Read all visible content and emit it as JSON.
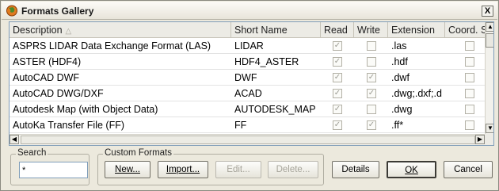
{
  "window": {
    "title": "Formats Gallery",
    "close_label": "X"
  },
  "table": {
    "columns": [
      "Description",
      "Short Name",
      "Read",
      "Write",
      "Extension",
      "Coord. S"
    ],
    "rows": [
      {
        "description": "ASPRS LIDAR Data Exchange Format (LAS)",
        "short_name": "LIDAR",
        "read": true,
        "write": false,
        "extension": ".las",
        "coord": false
      },
      {
        "description": "ASTER (HDF4)",
        "short_name": "HDF4_ASTER",
        "read": true,
        "write": false,
        "extension": ".hdf",
        "coord": false
      },
      {
        "description": "AutoCAD DWF",
        "short_name": "DWF",
        "read": true,
        "write": true,
        "extension": ".dwf",
        "coord": false
      },
      {
        "description": "AutoCAD DWG/DXF",
        "short_name": "ACAD",
        "read": true,
        "write": true,
        "extension": ".dwg;.dxf;.d",
        "coord": false
      },
      {
        "description": "Autodesk Map (with Object Data)",
        "short_name": "AUTODESK_MAP",
        "read": true,
        "write": false,
        "extension": ".dwg",
        "coord": false
      },
      {
        "description": "AutoKa Transfer File (FF)",
        "short_name": "FF",
        "read": true,
        "write": true,
        "extension": ".ff*",
        "coord": false
      }
    ]
  },
  "search": {
    "label": "Search",
    "value": "*"
  },
  "custom_formats": {
    "label": "Custom Formats",
    "new_label": "New...",
    "import_label": "Import...",
    "edit_label": "Edit...",
    "delete_label": "Delete..."
  },
  "buttons": {
    "details": "Details",
    "ok": "OK",
    "cancel": "Cancel"
  },
  "icons": {
    "app": "world-icon",
    "check": "✓"
  }
}
